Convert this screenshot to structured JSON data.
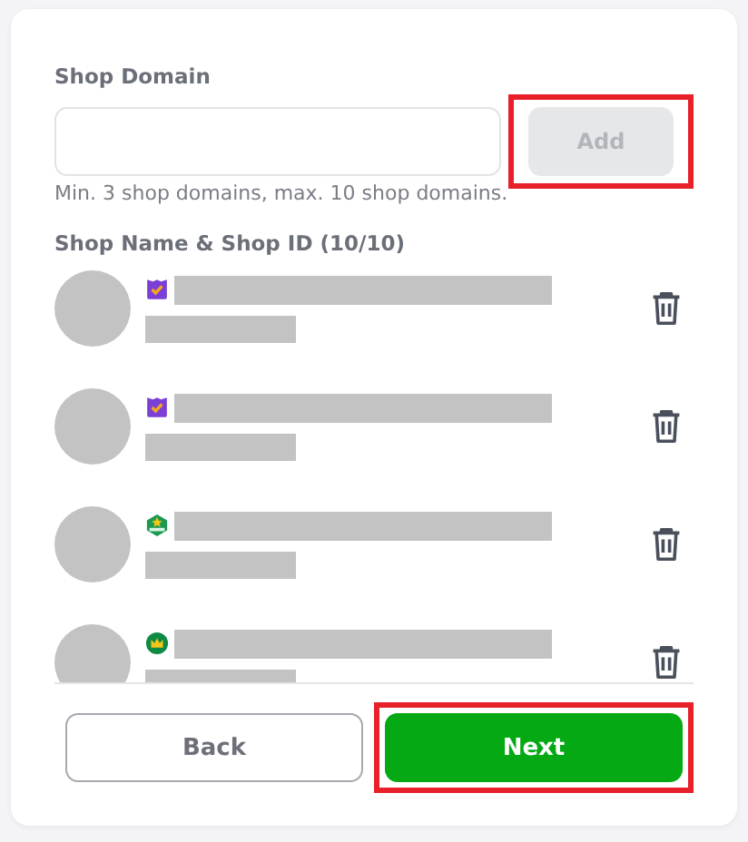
{
  "shop_domain": {
    "label": "Shop Domain",
    "add_button": {
      "label": "Add",
      "disabled": true,
      "highlighted": true
    },
    "hint": "Min. 3 shop domains, max. 10 shop domains."
  },
  "shops": {
    "label": "Shop Name & Shop ID (10/10)",
    "rows": [
      {
        "kind": "verified"
      },
      {
        "kind": "verified"
      },
      {
        "kind": "pro"
      },
      {
        "kind": "crown"
      }
    ]
  },
  "buttons": [
    {
      "label": "Back",
      "kind": "secondary",
      "highlighted": false
    },
    {
      "label": "Next",
      "kind": "primary",
      "highlighted": true
    }
  ]
}
